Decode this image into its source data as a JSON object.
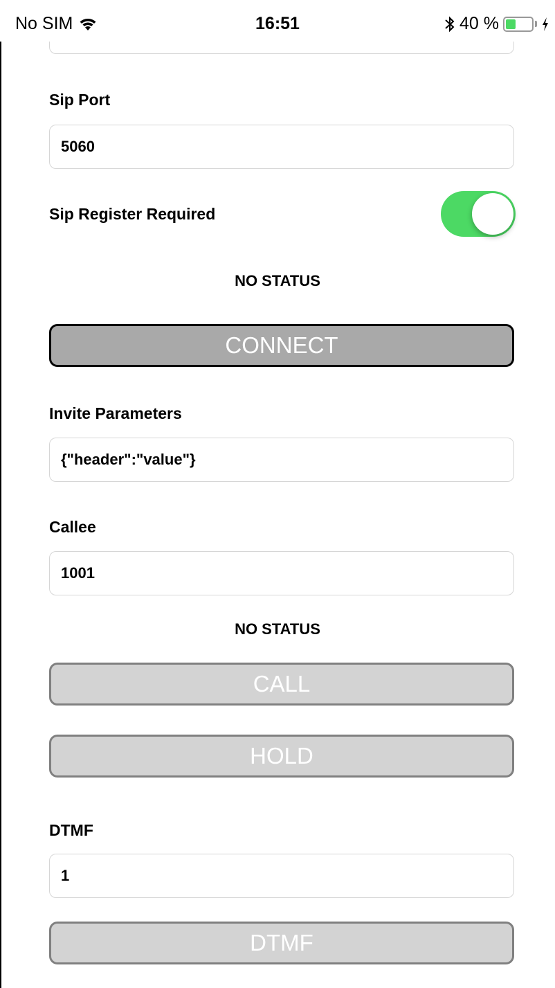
{
  "status_bar": {
    "carrier": "No SIM",
    "time": "16:51",
    "battery_text": "40 %",
    "battery_level": 0.4,
    "battery_color": "#4cd964"
  },
  "sip_port": {
    "label": "Sip Port",
    "value": "5060"
  },
  "sip_register": {
    "label": "Sip Register Required",
    "enabled": true,
    "toggle_color": "#4cd964"
  },
  "connection_status": "NO STATUS",
  "connect_button": "CONNECT",
  "invite_parameters": {
    "label": "Invite Parameters",
    "value": "{\"header\":\"value\"}"
  },
  "callee": {
    "label": "Callee",
    "value": "1001"
  },
  "call_status": "NO STATUS",
  "call_button": "CALL",
  "hold_button": "HOLD",
  "dtmf": {
    "label": "DTMF",
    "value": "1"
  },
  "dtmf_button": "DTMF"
}
